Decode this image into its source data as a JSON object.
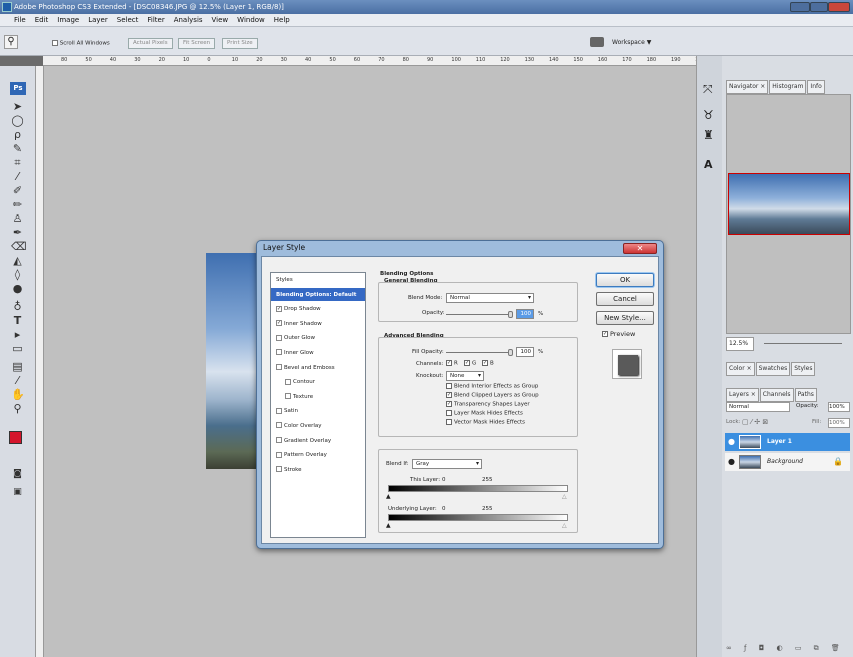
{
  "window": {
    "title": "Adobe Photoshop CS3 Extended - [DSC08346.JPG @ 12.5% (Layer 1, RGB/8)]"
  },
  "menu": [
    "File",
    "Edit",
    "Image",
    "Layer",
    "Select",
    "Filter",
    "Analysis",
    "View",
    "Window",
    "Help"
  ],
  "options": {
    "scroll_all": "Scroll All Windows",
    "actual_pixels": "Actual Pixels",
    "fit_screen": "Fit Screen",
    "print_size": "Print Size",
    "workspace": "Workspace ▼"
  },
  "ruler_ticks": [
    "80",
    "50",
    "40",
    "30",
    "20",
    "10",
    "0",
    "10",
    "20",
    "30",
    "40",
    "50",
    "60",
    "70",
    "80",
    "90",
    "100",
    "110",
    "120",
    "130",
    "140",
    "150",
    "160",
    "170",
    "180",
    "190",
    "20"
  ],
  "panels": {
    "nav_tabs": [
      "Navigator ×",
      "Histogram",
      "Info"
    ],
    "zoom": "12.5%",
    "color_tabs": [
      "Color ×",
      "Swatches",
      "Styles"
    ],
    "layer_tabs": [
      "Layers ×",
      "Channels",
      "Paths"
    ],
    "blend_mode": "Normal",
    "opacity_label": "Opacity:",
    "opacity_value": "100%",
    "lock_label": "Lock:",
    "fill_label": "Fill:",
    "fill_value": "100%",
    "layers": [
      {
        "name": "Layer 1"
      },
      {
        "name": "Background"
      }
    ]
  },
  "dialog": {
    "title": "Layer Style",
    "close": "✕",
    "styles": [
      {
        "label": "Styles",
        "check": false,
        "selected": false
      },
      {
        "label": "Blending Options: Default",
        "check": false,
        "selected": true
      },
      {
        "label": "Drop Shadow",
        "check": true,
        "checked": true
      },
      {
        "label": "Inner Shadow",
        "check": true,
        "checked": true
      },
      {
        "label": "Outer Glow",
        "check": true,
        "checked": false
      },
      {
        "label": "Inner Glow",
        "check": true,
        "checked": false
      },
      {
        "label": "Bevel and Emboss",
        "check": true,
        "checked": false
      },
      {
        "label": "Contour",
        "check": true,
        "checked": false,
        "indent": true
      },
      {
        "label": "Texture",
        "check": true,
        "checked": false,
        "indent": true
      },
      {
        "label": "Satin",
        "check": true,
        "checked": false
      },
      {
        "label": "Color Overlay",
        "check": true,
        "checked": false
      },
      {
        "label": "Gradient Overlay",
        "check": true,
        "checked": false
      },
      {
        "label": "Pattern Overlay",
        "check": true,
        "checked": false
      },
      {
        "label": "Stroke",
        "check": true,
        "checked": false
      }
    ],
    "blending_options": "Blending Options",
    "general_blending": "General Blending",
    "blend_mode_label": "Blend Mode:",
    "blend_mode_value": "Normal",
    "opacity_label": "Opacity:",
    "opacity_value": "100",
    "percent": "%",
    "advanced_blending": "Advanced Blending",
    "fill_opacity_label": "Fill Opacity:",
    "fill_opacity_value": "100",
    "channels_label": "Channels:",
    "channel_r": "R",
    "channel_g": "G",
    "channel_b": "B",
    "knockout_label": "Knockout:",
    "knockout_value": "None",
    "options": [
      {
        "label": "Blend Interior Effects as Group",
        "checked": false
      },
      {
        "label": "Blend Clipped Layers as Group",
        "checked": true
      },
      {
        "label": "Transparency Shapes Layer",
        "checked": true
      },
      {
        "label": "Layer Mask Hides Effects",
        "checked": false
      },
      {
        "label": "Vector Mask Hides Effects",
        "checked": false
      }
    ],
    "blend_if_label": "Blend If:",
    "blend_if_value": "Gray",
    "this_layer_label": "This Layer:",
    "this_layer_min": "0",
    "this_layer_max": "255",
    "underlying_label": "Underlying Layer:",
    "underlying_min": "0",
    "underlying_max": "255",
    "ok": "OK",
    "cancel": "Cancel",
    "new_style": "New Style...",
    "preview": "Preview"
  }
}
